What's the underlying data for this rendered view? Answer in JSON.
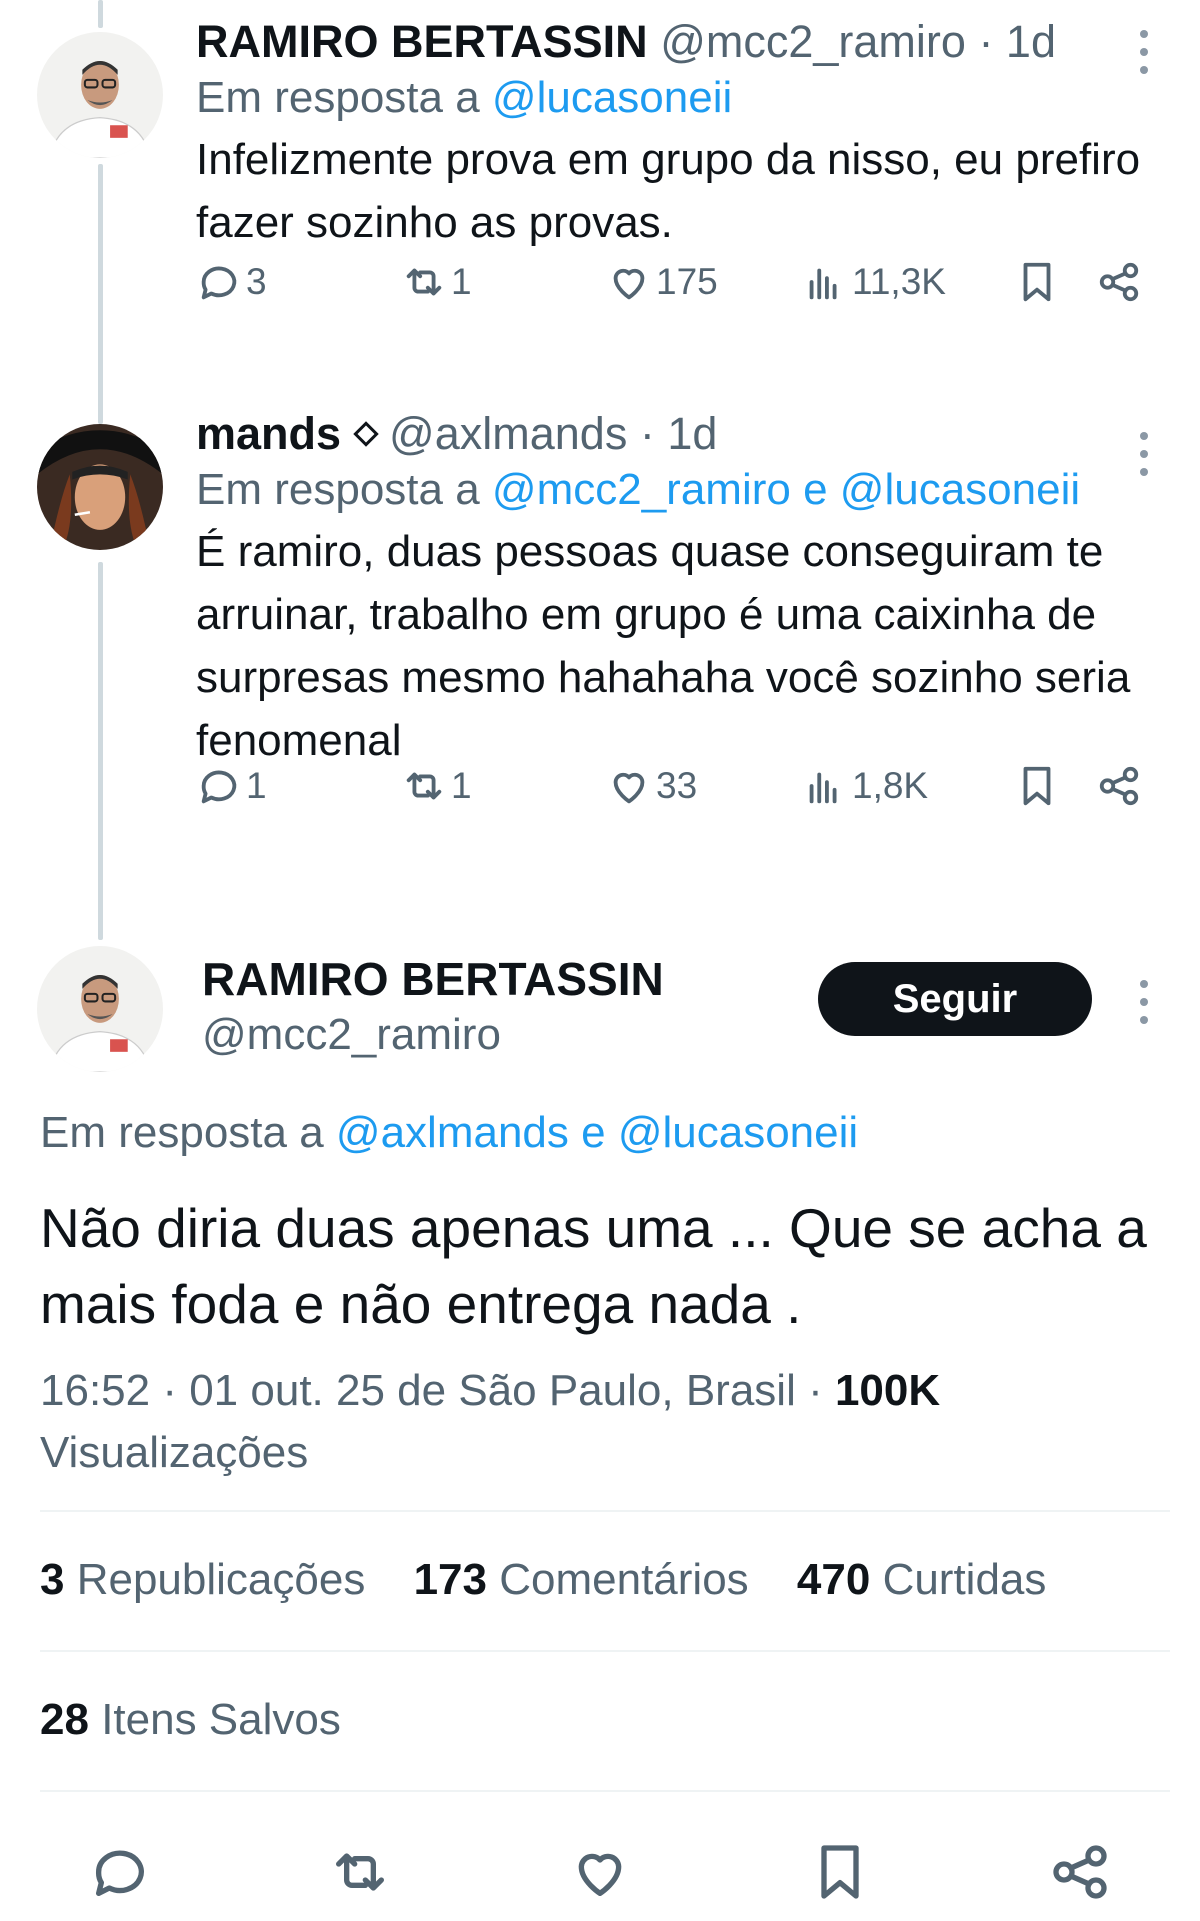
{
  "replies": [
    {
      "name": "RAMIRO BERTASSIN",
      "handle": "@mcc2_ramiro",
      "time": "· 1d",
      "reply_prefix": "Em resposta a",
      "reply_to": "@lucasoneii",
      "text": "Infelizmente prova em grupo da nisso, eu prefiro fazer sozinho as provas.",
      "comments": "3",
      "reposts": "1",
      "likes": "175",
      "views": "11,3K"
    },
    {
      "name": "mands",
      "handle": "@axlmands",
      "time": "· 1d",
      "reply_prefix": "Em resposta a",
      "reply_to": "@mcc2_ramiro e @lucasoneii",
      "text": "É ramiro, duas pessoas quase conseguiram te arruinar, trabalho em grupo é uma caixinha de surpresas mesmo hahahaha você sozinho seria fenomenal",
      "comments": "1",
      "reposts": "1",
      "likes": "33",
      "views": "1,8K"
    }
  ],
  "main_tweet": {
    "name": "RAMIRO BERTASSIN",
    "handle": "@mcc2_ramiro",
    "follow_label": "Seguir",
    "reply_prefix": "Em resposta a",
    "reply_to": "@axlmands e @lucasoneii",
    "text": "Não diria duas apenas uma ... Que se acha a mais foda e não entrega nada .",
    "meta_time": "16:52 · 01 out. 25 de São Paulo, Brasil · ",
    "views_count": "100K",
    "views_label": "Visualizações",
    "stats": {
      "reposts_count": "3",
      "reposts_label": "Republicações",
      "comments_count": "173",
      "comments_label": "Comentários",
      "likes_count": "470",
      "likes_label": "Curtidas",
      "saved_count": "28",
      "saved_label": "Itens Salvos"
    }
  },
  "colors": {
    "link": "#1d9bf0",
    "secondary_text": "#536471",
    "primary_text": "#0f1419",
    "follow_button_bg": "#0f1419"
  },
  "icons": [
    "comment-icon",
    "repost-icon",
    "like-icon",
    "views-icon",
    "bookmark-icon",
    "share-icon",
    "more-icon"
  ]
}
